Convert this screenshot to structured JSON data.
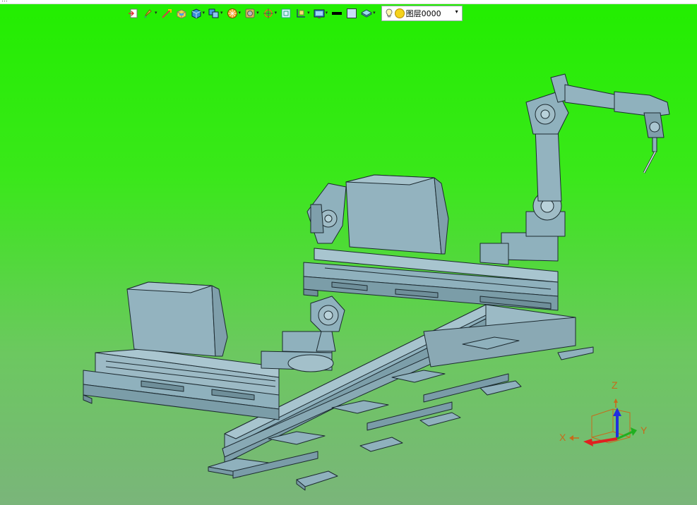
{
  "window": {
    "title_fragment": "…"
  },
  "toolbar": {
    "items": [
      {
        "icon": "import-icon",
        "dropdown": false
      },
      {
        "icon": "sketch-pen-icon",
        "dropdown": true
      },
      {
        "icon": "edit-curve-icon",
        "dropdown": false
      },
      {
        "icon": "solid-box-icon",
        "dropdown": false
      },
      {
        "icon": "view-cube-icon",
        "dropdown": true
      },
      {
        "icon": "display-mode-icon",
        "dropdown": true
      },
      {
        "icon": "render-style-icon",
        "dropdown": true
      },
      {
        "icon": "appearance-icon",
        "dropdown": true
      },
      {
        "icon": "orient-icon",
        "dropdown": true
      },
      {
        "icon": "fit-view-icon",
        "dropdown": false
      },
      {
        "icon": "section-view-icon",
        "dropdown": true
      },
      {
        "icon": "screenshot-icon",
        "dropdown": true
      },
      {
        "icon": "line-color-icon",
        "dropdown": false
      },
      {
        "icon": "fill-color-icon",
        "dropdown": false
      },
      {
        "icon": "layers-icon",
        "dropdown": true
      }
    ],
    "layer": {
      "name": "图层0000",
      "dropdown_arrow": "▾"
    }
  },
  "triad": {
    "x_label": "X",
    "y_label": "Y",
    "z_label": "Z",
    "colors": {
      "x": "#e02020",
      "y": "#20b020",
      "z": "#2030e0"
    }
  },
  "colors": {
    "model_fill": "#8fb1bd",
    "model_edge": "#1c2a30",
    "bg_top": "#22ee00",
    "bg_bottom": "#7ab57a"
  }
}
